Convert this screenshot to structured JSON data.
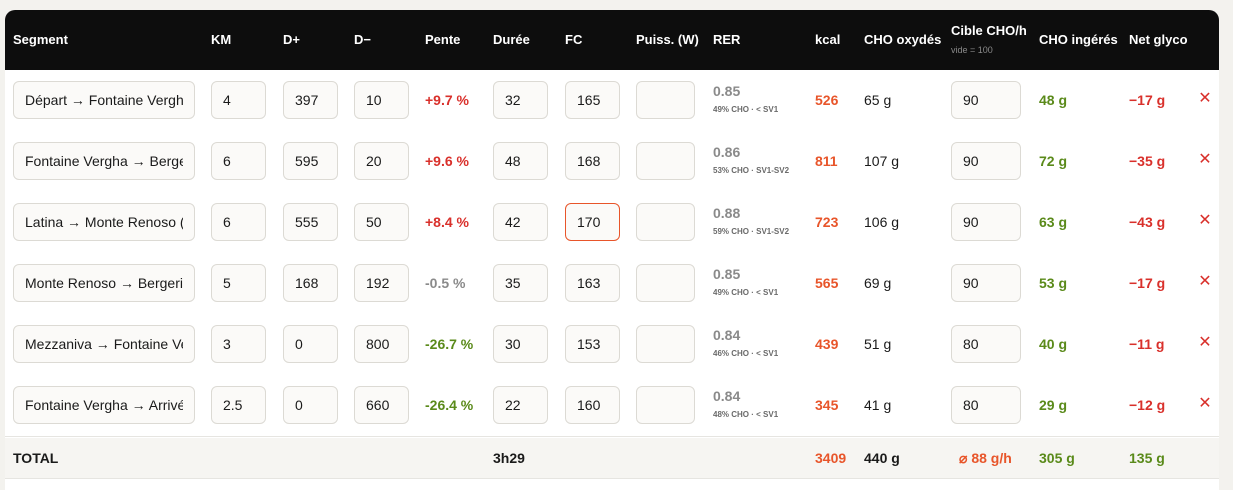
{
  "headers": {
    "segment": "Segment",
    "km": "KM",
    "dplus": "D+",
    "dminus": "D−",
    "pente": "Pente",
    "duree": "Durée",
    "fc": "FC",
    "puiss": "Puiss. (W)",
    "rer": "RER",
    "kcal": "kcal",
    "cho_oxydes": "CHO oxydés",
    "cible": "Cible CHO/h",
    "cible_sub": "vide = 100",
    "cho_ingeres": "CHO ingérés",
    "net_glyco": "Net glyco"
  },
  "rows": [
    {
      "segment": "Départ → Fontaine Vergha",
      "km": "4",
      "dplus": "397",
      "dminus": "10",
      "pente": "+9.7 %",
      "pente_class": "pos",
      "duree": "32",
      "fc": "165",
      "puiss": "",
      "rer": "0.85",
      "rer_sub": "49% CHO · < SV1",
      "kcal": "526",
      "cho_ox": "65 g",
      "cible": "90",
      "cho_ing": "48 g",
      "net": "−17 g"
    },
    {
      "segment": "Fontaine Vergha → Bergeries",
      "km": "6",
      "dplus": "595",
      "dminus": "20",
      "pente": "+9.6 %",
      "pente_class": "pos",
      "duree": "48",
      "fc": "168",
      "puiss": "",
      "rer": "0.86",
      "rer_sub": "53% CHO · SV1-SV2",
      "kcal": "811",
      "cho_ox": "107 g",
      "cible": "90",
      "cho_ing": "72 g",
      "net": "−35 g"
    },
    {
      "segment": "Latina → Monte Renoso (",
      "km": "6",
      "dplus": "555",
      "dminus": "50",
      "pente": "+8.4 %",
      "pente_class": "pos",
      "duree": "42",
      "fc": "170",
      "puiss": "",
      "rer": "0.88",
      "rer_sub": "59% CHO · SV1-SV2",
      "kcal": "723",
      "cho_ox": "106 g",
      "cible": "90",
      "cho_ing": "63 g",
      "net": "−43 g"
    },
    {
      "segment": "Monte Renoso → Bergeries",
      "km": "5",
      "dplus": "168",
      "dminus": "192",
      "pente": "-0.5 %",
      "pente_class": "neu",
      "duree": "35",
      "fc": "163",
      "puiss": "",
      "rer": "0.85",
      "rer_sub": "49% CHO · < SV1",
      "kcal": "565",
      "cho_ox": "69 g",
      "cible": "90",
      "cho_ing": "53 g",
      "net": "−17 g"
    },
    {
      "segment": "Mezzaniva → Fontaine Vergha",
      "km": "3",
      "dplus": "0",
      "dminus": "800",
      "pente": "-26.7 %",
      "pente_class": "neg",
      "duree": "30",
      "fc": "153",
      "puiss": "",
      "rer": "0.84",
      "rer_sub": "46% CHO · < SV1",
      "kcal": "439",
      "cho_ox": "51 g",
      "cible": "80",
      "cho_ing": "40 g",
      "net": "−11 g"
    },
    {
      "segment": "Fontaine Vergha → Arrivée",
      "km": "2.5",
      "dplus": "0",
      "dminus": "660",
      "pente": "-26.4 %",
      "pente_class": "neg",
      "duree": "22",
      "fc": "160",
      "puiss": "",
      "rer": "0.84",
      "rer_sub": "48% CHO · < SV1",
      "kcal": "345",
      "cho_ox": "41 g",
      "cible": "80",
      "cho_ing": "29 g",
      "net": "−12 g"
    }
  ],
  "delete_glyph": "✕",
  "total": {
    "label": "TOTAL",
    "duree": "3h29",
    "kcal": "3409",
    "cho_ox": "440 g",
    "cible": "⌀ 88 g/h",
    "cho_ing": "305 g",
    "net": "135 g"
  },
  "colors": {
    "accent": "#e8552a",
    "negative": "#d9302b",
    "positive": "#5a8a1a",
    "header_bg": "#0d0d0d"
  }
}
